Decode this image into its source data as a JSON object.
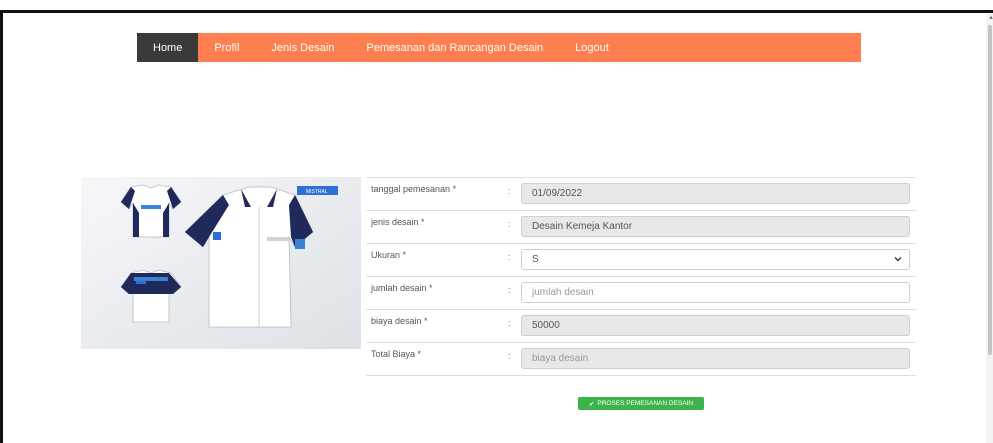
{
  "nav": {
    "items": [
      {
        "label": "Home",
        "active": true
      },
      {
        "label": "Profil"
      },
      {
        "label": "Jenis Desain"
      },
      {
        "label": "Pemesanan dan Rancangan Desain"
      },
      {
        "label": "Logout"
      }
    ],
    "colors": {
      "bar": "#ff7f50",
      "active": "#3a3a3a"
    }
  },
  "product": {
    "brand_text": "MISTRAL",
    "icon": "shirt-design-image"
  },
  "form": {
    "rows": [
      {
        "label": "tanggal pemesanan *",
        "value": "01/09/2022",
        "readonly": true
      },
      {
        "label": "jenis desain *",
        "value": "Desain Kemeja Kantor",
        "readonly": true
      },
      {
        "label": "Ukuran *",
        "value": "S",
        "type": "select"
      },
      {
        "label": "jumlah desain *",
        "value": "",
        "placeholder": "jumlah desain"
      },
      {
        "label": "biaya desain *",
        "value": "50000",
        "readonly": true
      },
      {
        "label": "Total Biaya *",
        "value": "",
        "placeholder": "biaya desain",
        "readonly": true
      }
    ],
    "separator": ":"
  },
  "submit": {
    "label": "PROSES PEMESANAN DESAIN",
    "icon": "check-icon",
    "color": "#3cb44b"
  }
}
